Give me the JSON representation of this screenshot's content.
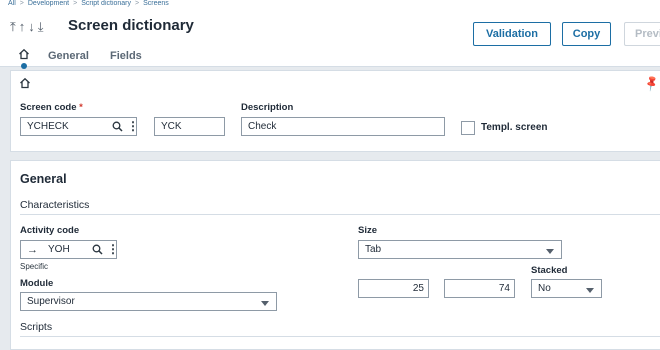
{
  "breadcrumb": [
    "All",
    "Development",
    "Script dictionary",
    "Screens"
  ],
  "header": {
    "title": "Screen dictionary",
    "validation_label": "Validation",
    "copy_label": "Copy",
    "preview_label": "Previ"
  },
  "tabs": {
    "general": "General",
    "fields": "Fields"
  },
  "top_panel": {
    "screen_code_label": "Screen code",
    "required_mark": "*",
    "screen_code_value": "YCHECK",
    "abbrev_value": "YCK",
    "description_label": "Description",
    "description_value": "Check",
    "templ_screen_label": "Templ. screen"
  },
  "general": {
    "section_title": "General",
    "characteristics_label": "Characteristics",
    "activity_code_label": "Activity code",
    "activity_code_value": "YOH",
    "activity_code_hint": "Specific",
    "module_label": "Module",
    "module_value": "Supervisor",
    "size_label": "Size",
    "size_value": "Tab",
    "size_width": "25",
    "size_height": "74",
    "stacked_label": "Stacked",
    "stacked_value": "No",
    "scripts_label": "Scripts"
  },
  "colors": {
    "accent": "#1c6ea4",
    "required": "#d23b2f",
    "background": "#e6eaee"
  }
}
